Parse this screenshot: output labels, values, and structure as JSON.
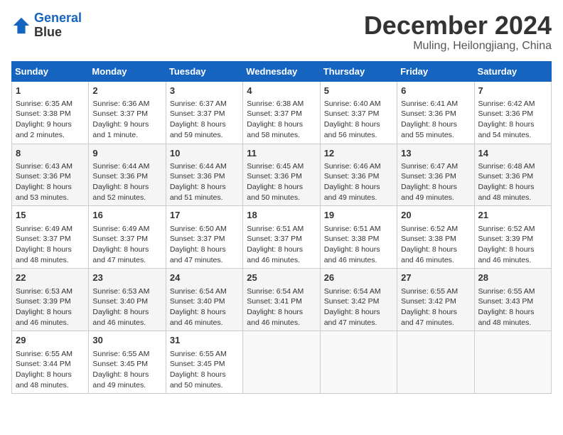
{
  "header": {
    "logo_line1": "General",
    "logo_line2": "Blue",
    "month_title": "December 2024",
    "location": "Muling, Heilongjiang, China"
  },
  "weekdays": [
    "Sunday",
    "Monday",
    "Tuesday",
    "Wednesday",
    "Thursday",
    "Friday",
    "Saturday"
  ],
  "weeks": [
    [
      {
        "day": "1",
        "sunrise": "6:35 AM",
        "sunset": "3:38 PM",
        "daylight": "9 hours and 2 minutes."
      },
      {
        "day": "2",
        "sunrise": "6:36 AM",
        "sunset": "3:37 PM",
        "daylight": "9 hours and 1 minute."
      },
      {
        "day": "3",
        "sunrise": "6:37 AM",
        "sunset": "3:37 PM",
        "daylight": "8 hours and 59 minutes."
      },
      {
        "day": "4",
        "sunrise": "6:38 AM",
        "sunset": "3:37 PM",
        "daylight": "8 hours and 58 minutes."
      },
      {
        "day": "5",
        "sunrise": "6:40 AM",
        "sunset": "3:37 PM",
        "daylight": "8 hours and 56 minutes."
      },
      {
        "day": "6",
        "sunrise": "6:41 AM",
        "sunset": "3:36 PM",
        "daylight": "8 hours and 55 minutes."
      },
      {
        "day": "7",
        "sunrise": "6:42 AM",
        "sunset": "3:36 PM",
        "daylight": "8 hours and 54 minutes."
      }
    ],
    [
      {
        "day": "8",
        "sunrise": "6:43 AM",
        "sunset": "3:36 PM",
        "daylight": "8 hours and 53 minutes."
      },
      {
        "day": "9",
        "sunrise": "6:44 AM",
        "sunset": "3:36 PM",
        "daylight": "8 hours and 52 minutes."
      },
      {
        "day": "10",
        "sunrise": "6:44 AM",
        "sunset": "3:36 PM",
        "daylight": "8 hours and 51 minutes."
      },
      {
        "day": "11",
        "sunrise": "6:45 AM",
        "sunset": "3:36 PM",
        "daylight": "8 hours and 50 minutes."
      },
      {
        "day": "12",
        "sunrise": "6:46 AM",
        "sunset": "3:36 PM",
        "daylight": "8 hours and 49 minutes."
      },
      {
        "day": "13",
        "sunrise": "6:47 AM",
        "sunset": "3:36 PM",
        "daylight": "8 hours and 49 minutes."
      },
      {
        "day": "14",
        "sunrise": "6:48 AM",
        "sunset": "3:36 PM",
        "daylight": "8 hours and 48 minutes."
      }
    ],
    [
      {
        "day": "15",
        "sunrise": "6:49 AM",
        "sunset": "3:37 PM",
        "daylight": "8 hours and 48 minutes."
      },
      {
        "day": "16",
        "sunrise": "6:49 AM",
        "sunset": "3:37 PM",
        "daylight": "8 hours and 47 minutes."
      },
      {
        "day": "17",
        "sunrise": "6:50 AM",
        "sunset": "3:37 PM",
        "daylight": "8 hours and 47 minutes."
      },
      {
        "day": "18",
        "sunrise": "6:51 AM",
        "sunset": "3:37 PM",
        "daylight": "8 hours and 46 minutes."
      },
      {
        "day": "19",
        "sunrise": "6:51 AM",
        "sunset": "3:38 PM",
        "daylight": "8 hours and 46 minutes."
      },
      {
        "day": "20",
        "sunrise": "6:52 AM",
        "sunset": "3:38 PM",
        "daylight": "8 hours and 46 minutes."
      },
      {
        "day": "21",
        "sunrise": "6:52 AM",
        "sunset": "3:39 PM",
        "daylight": "8 hours and 46 minutes."
      }
    ],
    [
      {
        "day": "22",
        "sunrise": "6:53 AM",
        "sunset": "3:39 PM",
        "daylight": "8 hours and 46 minutes."
      },
      {
        "day": "23",
        "sunrise": "6:53 AM",
        "sunset": "3:40 PM",
        "daylight": "8 hours and 46 minutes."
      },
      {
        "day": "24",
        "sunrise": "6:54 AM",
        "sunset": "3:40 PM",
        "daylight": "8 hours and 46 minutes."
      },
      {
        "day": "25",
        "sunrise": "6:54 AM",
        "sunset": "3:41 PM",
        "daylight": "8 hours and 46 minutes."
      },
      {
        "day": "26",
        "sunrise": "6:54 AM",
        "sunset": "3:42 PM",
        "daylight": "8 hours and 47 minutes."
      },
      {
        "day": "27",
        "sunrise": "6:55 AM",
        "sunset": "3:42 PM",
        "daylight": "8 hours and 47 minutes."
      },
      {
        "day": "28",
        "sunrise": "6:55 AM",
        "sunset": "3:43 PM",
        "daylight": "8 hours and 48 minutes."
      }
    ],
    [
      {
        "day": "29",
        "sunrise": "6:55 AM",
        "sunset": "3:44 PM",
        "daylight": "8 hours and 48 minutes."
      },
      {
        "day": "30",
        "sunrise": "6:55 AM",
        "sunset": "3:45 PM",
        "daylight": "8 hours and 49 minutes."
      },
      {
        "day": "31",
        "sunrise": "6:55 AM",
        "sunset": "3:45 PM",
        "daylight": "8 hours and 50 minutes."
      },
      null,
      null,
      null,
      null
    ]
  ]
}
